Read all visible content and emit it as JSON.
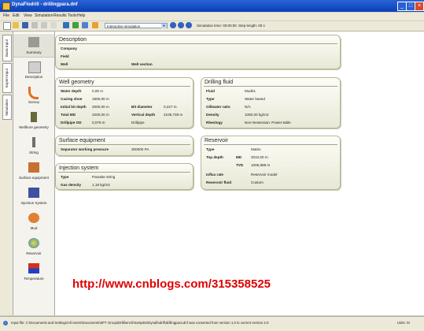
{
  "window": {
    "title": "DynaFlodrill - drillingpara.dnf"
  },
  "menu": [
    "File",
    "Edit",
    "View",
    "Simulation",
    "Results",
    "Tools",
    "Help"
  ],
  "toolbar": {
    "mode_select": "Interactive simulation",
    "simulation_time": "Simulation time: 00:00:00",
    "step_length": "Step length: 00 s"
  },
  "side_tabs": [
    "Basic input",
    "Expert input",
    "Simulation"
  ],
  "nav": [
    "Summary",
    "Description",
    "Survey",
    "Wellbore geometry",
    "String",
    "Surface equipment",
    "Injection System",
    "Mud",
    "Reservoir",
    "Temperature"
  ],
  "description": {
    "title": "Description",
    "company_label": "Company",
    "field_label": "Field",
    "well_label": "Well",
    "well_section_label": "Well section"
  },
  "well_geometry": {
    "title": "Well geometry",
    "water_depth_label": "Water depth",
    "water_depth": "0,00 m",
    "casing_shoe_label": "Casing shoe",
    "casing_shoe": "1800,00 m",
    "initial_bit_label": "Initial bit depth",
    "initial_bit": "2000,00 m",
    "total_md_label": "Total MD",
    "total_md": "2200,00 m",
    "drillpipe_od_label": "Drillpipe OD",
    "drillpipe_od": "0,076 m",
    "bit_diameter_label": "Bit diameter",
    "bit_diameter": "0,227 m",
    "vertical_depth_label": "Vertical depth",
    "vertical_depth": "2106,738 m",
    "drillpipe_label": "Drillpipe"
  },
  "drilling_fluid": {
    "title": "Drilling fluid",
    "fluid_label": "Fluid",
    "fluid": "Mud01",
    "type_label": "Type",
    "type": "Water based",
    "oil_water_label": "Oil/water ratio",
    "oil_water": "N/A",
    "density_label": "Density",
    "density": "1050,00 kg/m3",
    "rheology_label": "Rheology",
    "rheology": "Non-Newtonian: Power-table"
  },
  "surface_equipment": {
    "title": "Surface equipment",
    "separator_label": "Separator working pressure",
    "separator": "300000 PA"
  },
  "injection_system": {
    "title": "Injection system",
    "type_label": "Type",
    "type": "Parasite string",
    "gas_density_label": "Gas density",
    "gas_density": "1,18 kg/m3"
  },
  "reservoir": {
    "title": "Reservoir",
    "type_label": "Type",
    "type": "Matrix",
    "top_depth_label": "Top depth",
    "md_label": "MD",
    "md": "2010,00 m",
    "tvd_label": "TVD",
    "tvd": "1005,898 m",
    "influx_label": "Influx rate",
    "influx": "Reservoir model",
    "fluid_label": "Reservoir fluid",
    "fluid": "Custom"
  },
  "watermark": "http://www.cnblogs.com/315358525",
  "status": {
    "message": "Input file: C:\\Documents and Settings\\All Users\\Documents\\SPT Group\\Drillbench\\Samples\\Dynaflodrill\\drillingpara.dnf was converted from version 1.0 to current version 2.0",
    "units": "Units: SI"
  }
}
